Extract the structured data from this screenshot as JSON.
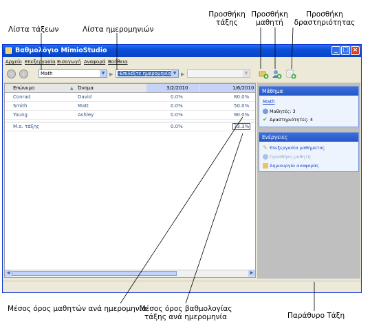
{
  "callouts": {
    "class_list": "Λίστα τάξεων",
    "date_list": "Λίστα ημερομηνιών",
    "add_class": [
      "Προσθήκη",
      "τάξης"
    ],
    "add_student": [
      "Προσθήκη",
      "μαθητή"
    ],
    "add_activity": [
      "Προσθήκη",
      "δραστηριότητας"
    ],
    "student_avg": "Μέσος όρος μαθητών ανά ημερομηνία",
    "class_avg": [
      "Μέσος όρος βαθμολογίας",
      "τάξης ανά ημερομηνία"
    ],
    "class_pane": "Παράθυρο Τάξη"
  },
  "window": {
    "title": "Βαθμολόγιο MimioStudio",
    "menu": [
      "Αρχείο",
      "Επεξεργασία",
      "Εισαγωγή",
      "Αναφορά",
      "Βοήθεια"
    ],
    "class_combo": "Math",
    "date_combo": "-Επιλέξτε ημερομηνία-"
  },
  "grid": {
    "headers": [
      "Επώνυμο",
      "Όνομα",
      "3/2/2010",
      "1/6/2010"
    ],
    "rows": [
      {
        "last": "Conrad",
        "first": "David",
        "d1": "0.0%",
        "d2": "80.0%"
      },
      {
        "last": "Smith",
        "first": "Matt",
        "d1": "0.0%",
        "d2": "50.0%"
      },
      {
        "last": "Young",
        "first": "Ashley",
        "d1": "0.0%",
        "d2": "90.0%"
      }
    ],
    "avg": {
      "label": "Μ.ο. τάξης",
      "d1": "0.0%",
      "d2": "73.3%"
    }
  },
  "side": {
    "lesson_header": "Μάθημα",
    "lesson_name": "Math",
    "students": "Μαθητές: 3",
    "activities": "Δραστηριότητες: 4",
    "actions_header": "Ενέργειες",
    "actions": [
      "Επεξεργασία μαθήματος",
      "Προσθήκη μαθητή",
      "Δημιουργία αναφοράς"
    ]
  }
}
